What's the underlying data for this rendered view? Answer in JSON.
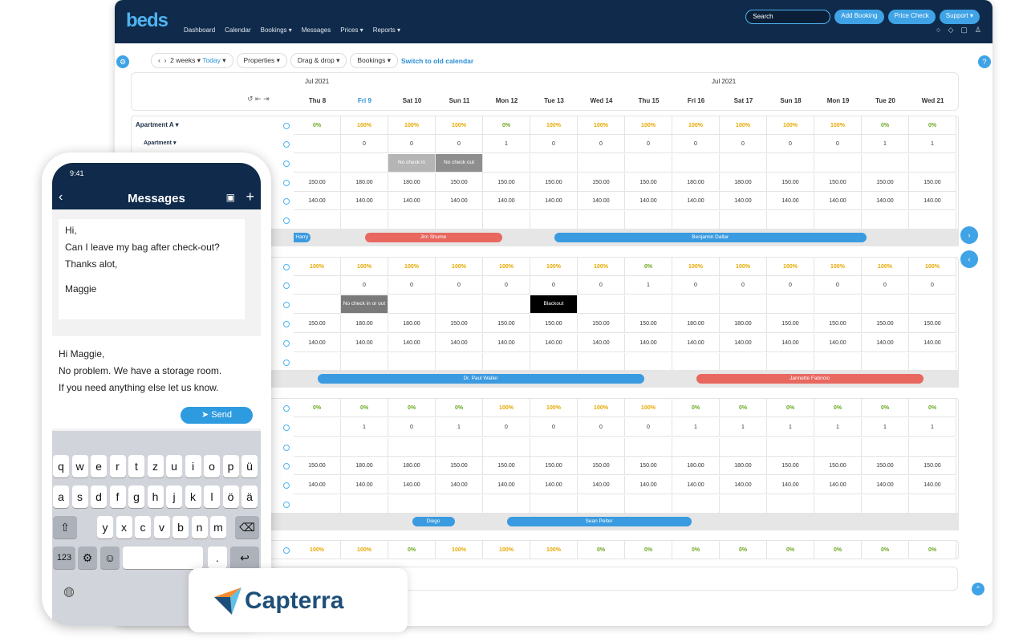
{
  "header": {
    "logo": "beds",
    "nav": [
      "Dashboard",
      "Calendar",
      "Bookings ▾",
      "Messages",
      "Prices ▾",
      "Reports ▾"
    ],
    "search_placeholder": "Search",
    "add_booking": "Add Booking",
    "price_check": "Price Check",
    "support": "Support ▾"
  },
  "toolbar": {
    "prev": "‹",
    "next": "›",
    "range": "2 weeks ▾",
    "today": "Today",
    "properties": "Properties ▾",
    "drag": "Drag & drop ▾",
    "bookings": "Bookings ▾",
    "switch": "Switch to old calendar"
  },
  "calendar": {
    "months": [
      "Jul 2021",
      "Jul 2021"
    ],
    "days": [
      "Thu 8",
      "Fri 9",
      "Sat 10",
      "Sun 11",
      "Mon 12",
      "Tue 13",
      "Wed 14",
      "Thu 15",
      "Fri 16",
      "Sat 17",
      "Sun 18",
      "Mon 19",
      "Tue 20",
      "Wed 21"
    ],
    "today_index": 1,
    "property": "Apartment A ▾",
    "room": "Apartment ▾",
    "colors": {
      "full": "#e6a800",
      "empty": "#6aa820",
      "blue": "#3a9be0",
      "red": "#e8675f"
    },
    "blocks": [
      {
        "occ": [
          "0%",
          "100%",
          "100%",
          "100%",
          "0%",
          "100%",
          "100%",
          "100%",
          "100%",
          "100%",
          "100%",
          "100%",
          "0%",
          "0%"
        ],
        "avail": [
          "",
          "0",
          "0",
          "0",
          "1",
          "0",
          "0",
          "0",
          "0",
          "0",
          "0",
          "0",
          "1",
          "1"
        ],
        "restr": [
          {
            "day": 2,
            "text": "No check in",
            "color": "#b5b5b5"
          },
          {
            "day": 3,
            "text": "No check out",
            "color": "#8e8e8e"
          }
        ],
        "p1": [
          "150.00",
          "180.00",
          "180.00",
          "150.00",
          "150.00",
          "150.00",
          "150.00",
          "150.00",
          "180.00",
          "180.00",
          "150.00",
          "150.00",
          "150.00",
          "150.00"
        ],
        "p2": [
          "140.00",
          "140.00",
          "140.00",
          "140.00",
          "140.00",
          "140.00",
          "140.00",
          "140.00",
          "140.00",
          "140.00",
          "140.00",
          "140.00",
          "140.00",
          "140.00"
        ],
        "bookings": [
          {
            "name": "Harry",
            "start": 0,
            "end": 0.35,
            "color": "blue"
          },
          {
            "name": "Jim Shume",
            "start": 1.5,
            "end": 4.4,
            "color": "red"
          },
          {
            "name": "Benjamin Dallar",
            "start": 5.5,
            "end": 12.1,
            "color": "blue"
          }
        ]
      },
      {
        "occ": [
          "100%",
          "100%",
          "100%",
          "100%",
          "100%",
          "100%",
          "100%",
          "0%",
          "100%",
          "100%",
          "100%",
          "100%",
          "100%",
          "100%"
        ],
        "avail": [
          "",
          "0",
          "0",
          "0",
          "0",
          "0",
          "0",
          "1",
          "0",
          "0",
          "0",
          "0",
          "0",
          "0"
        ],
        "restr": [
          {
            "day": 1,
            "text": "No check in or out",
            "color": "#7a7a7a"
          },
          {
            "day": 5,
            "text": "Blackout",
            "color": "#000000"
          }
        ],
        "p1": [
          "150.00",
          "180.00",
          "180.00",
          "150.00",
          "150.00",
          "150.00",
          "150.00",
          "150.00",
          "180.00",
          "180.00",
          "150.00",
          "150.00",
          "150.00",
          "150.00"
        ],
        "p2": [
          "140.00",
          "140.00",
          "140.00",
          "140.00",
          "140.00",
          "140.00",
          "140.00",
          "140.00",
          "140.00",
          "140.00",
          "140.00",
          "140.00",
          "140.00",
          "140.00"
        ],
        "bookings": [
          {
            "name": "Dr. Paul Waller",
            "start": 0.5,
            "end": 7.4,
            "color": "blue"
          },
          {
            "name": "Jannette Fabricio",
            "start": 8.5,
            "end": 13.3,
            "color": "red"
          }
        ]
      },
      {
        "occ": [
          "0%",
          "0%",
          "0%",
          "0%",
          "100%",
          "100%",
          "100%",
          "100%",
          "0%",
          "0%",
          "0%",
          "0%",
          "0%",
          "0%"
        ],
        "avail": [
          "",
          "1",
          "0",
          "1",
          "0",
          "0",
          "0",
          "0",
          "1",
          "1",
          "1",
          "1",
          "1",
          "1"
        ],
        "restr": [],
        "p1": [
          "150.00",
          "180.00",
          "180.00",
          "150.00",
          "150.00",
          "150.00",
          "150.00",
          "150.00",
          "180.00",
          "180.00",
          "150.00",
          "150.00",
          "150.00",
          "150.00"
        ],
        "p2": [
          "140.00",
          "140.00",
          "140.00",
          "140.00",
          "140.00",
          "140.00",
          "140.00",
          "140.00",
          "140.00",
          "140.00",
          "140.00",
          "140.00",
          "140.00",
          "140.00"
        ],
        "bookings": [
          {
            "name": "Diego",
            "start": 2.5,
            "end": 3.4,
            "color": "blue"
          },
          {
            "name": "Sean Pelter",
            "start": 4.5,
            "end": 8.4,
            "color": "blue"
          }
        ]
      },
      {
        "occ": [
          "100%",
          "100%",
          "0%",
          "100%",
          "100%",
          "100%",
          "0%",
          "0%",
          "0%",
          "0%",
          "0%",
          "0%",
          "0%",
          "0%"
        ]
      }
    ]
  },
  "phone": {
    "time": "9:41",
    "title": "Messages",
    "incoming": [
      "Hi,",
      "Can I leave my bag after check-out?",
      "Thanks alot,",
      "",
      "Maggie"
    ],
    "reply": [
      "Hi Maggie,",
      "No problem. We have a storage room.",
      "If you need anything else let us know."
    ],
    "send": "Send",
    "keys": [
      [
        "q",
        "w",
        "e",
        "r",
        "t",
        "z",
        "u",
        "i",
        "o",
        "p",
        "ü"
      ],
      [
        "a",
        "s",
        "d",
        "f",
        "g",
        "h",
        "j",
        "k",
        "l",
        "ö",
        "ä"
      ],
      [
        "y",
        "x",
        "c",
        "v",
        "b",
        "n",
        "m"
      ]
    ],
    "num_key": "123",
    "return_key": "↩"
  },
  "capterra": {
    "name": "Capterra"
  }
}
